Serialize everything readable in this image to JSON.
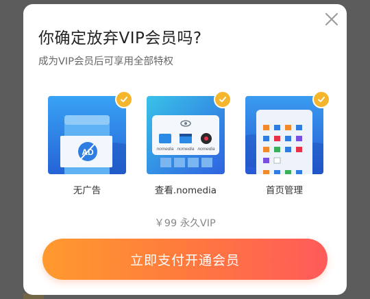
{
  "dialog": {
    "title": "你确定放弃VIP会员吗?",
    "subtitle": "成为VIP会员后可享用全部特权",
    "features": [
      {
        "label": "无广告",
        "icon": "ad-free-icon",
        "badge_text": "AD"
      },
      {
        "label": "查看.nomedia",
        "icon": "nomedia-icon",
        "tags": [
          "nomedia",
          "nomedia",
          "nomedia"
        ]
      },
      {
        "label": "首页管理",
        "icon": "home-manage-icon"
      }
    ],
    "price": "￥99 永久VIP",
    "buy_button": "立即支付开通会员"
  },
  "colors": {
    "accent_gradient_start": "#ff9a2e",
    "accent_gradient_end": "#ff5a5a",
    "check_badge": "#f5b52c",
    "thumb_blue": "#2a73e8"
  }
}
